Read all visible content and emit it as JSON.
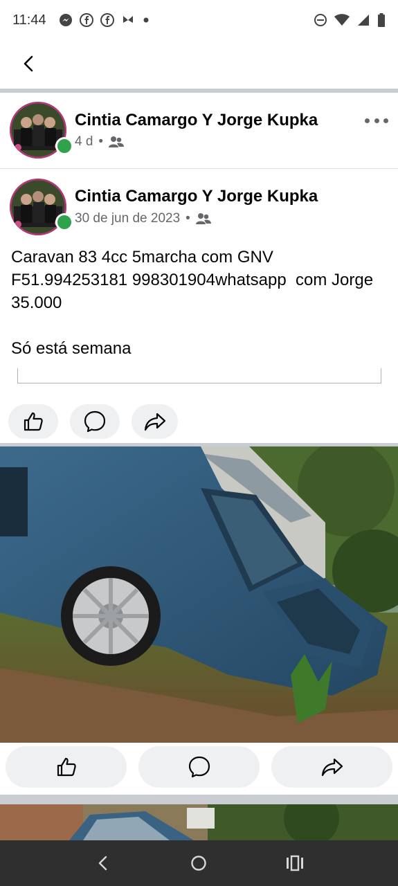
{
  "status_bar": {
    "time": "11:44",
    "notification_icons": [
      "messenger-icon",
      "facebook-icon",
      "facebook-icon",
      "butterfly-icon",
      "dot-icon"
    ],
    "system_icons": [
      "do-not-disturb-icon",
      "wifi-icon",
      "cellular-signal-icon",
      "battery-icon"
    ]
  },
  "group_header": {
    "author": "Cintia Camargo Y Jorge Kupka",
    "time_ago": "4 d",
    "separator": "•",
    "audience_icon": "friends-icon"
  },
  "post": {
    "author": "Cintia Camargo Y Jorge Kupka",
    "date": "30 de jun de 2023",
    "separator": "•",
    "audience_icon": "friends-icon",
    "text": "Caravan 83 4cc 5marcha com GNV F51.994253181 998301904whatsapp  com Jorge 35.000\n\nSó está semana"
  },
  "actions": [
    "like-icon",
    "comment-icon",
    "share-icon"
  ],
  "colors": {
    "online": "#31a24c",
    "pill_bg": "#eff0f2",
    "divider": "#c9ccd1",
    "car_blue": "#2f5a7a"
  },
  "nav_bar": [
    "back-icon",
    "home-icon",
    "recents-icon"
  ]
}
